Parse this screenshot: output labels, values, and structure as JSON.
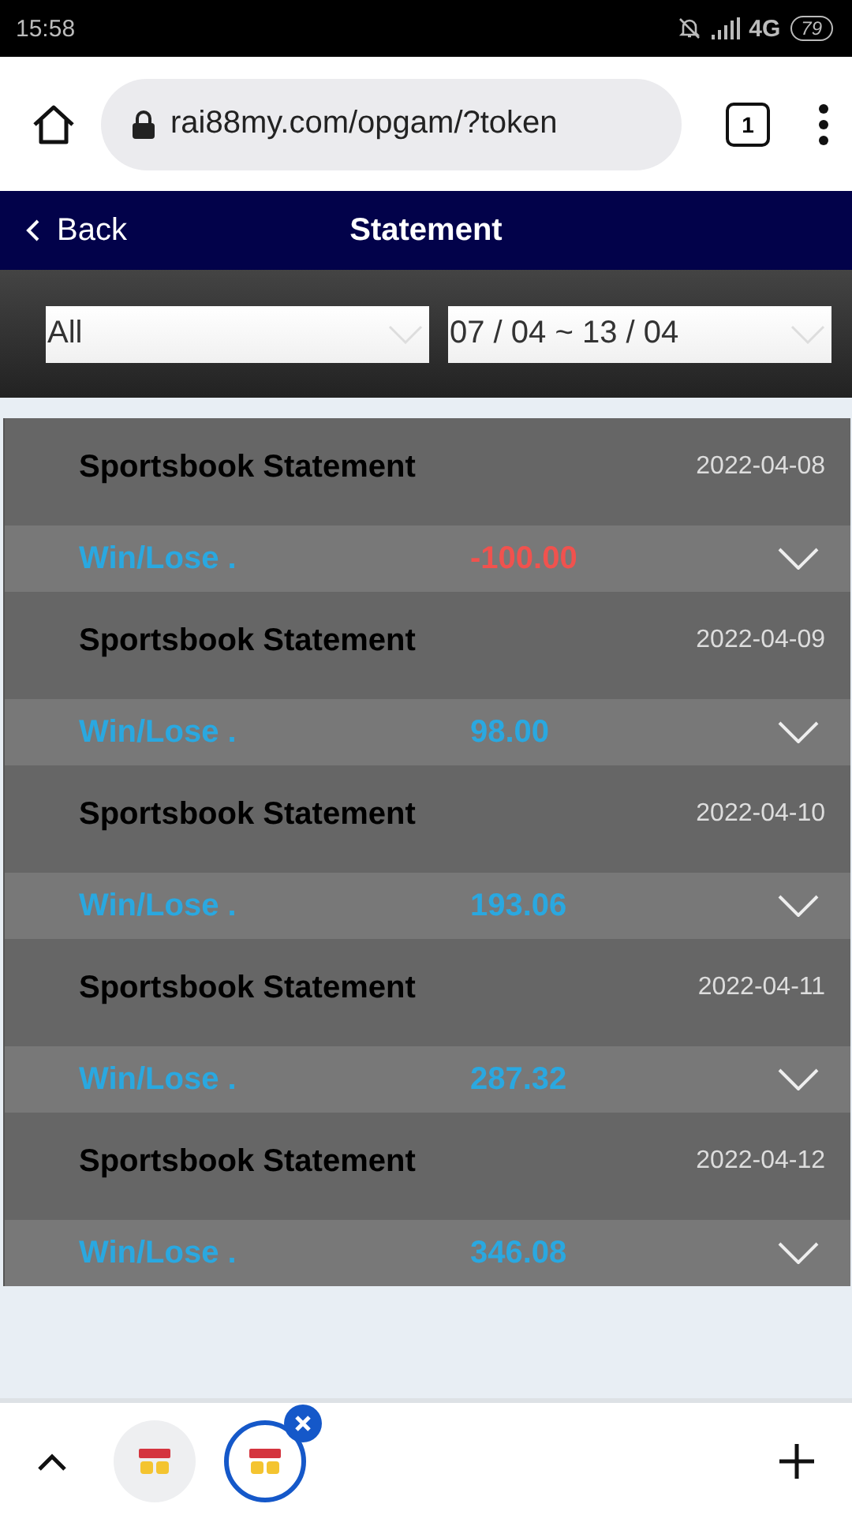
{
  "status_bar": {
    "time": "15:58",
    "network": "4G",
    "battery": "79"
  },
  "browser": {
    "url": "rai88my.com/opgam/?token",
    "tab_count": "1"
  },
  "header": {
    "back": "Back",
    "title": "Statement"
  },
  "filters": [
    {
      "value": "All"
    },
    {
      "value": "07 / 04 ~ 13 / 04"
    }
  ],
  "statements": [
    {
      "title": "Sportsbook Statement",
      "date": "2022-04-08",
      "label": "Win/Lose .",
      "amount": "-100.00",
      "color": "#f0524e"
    },
    {
      "title": "Sportsbook Statement",
      "date": "2022-04-09",
      "label": "Win/Lose .",
      "amount": "98.00",
      "color": "#2aa8e0"
    },
    {
      "title": "Sportsbook Statement",
      "date": "2022-04-10",
      "label": "Win/Lose .",
      "amount": "193.06",
      "color": "#2aa8e0"
    },
    {
      "title": "Sportsbook Statement",
      "date": "2022-04-11",
      "label": "Win/Lose .",
      "amount": "287.32",
      "color": "#2aa8e0"
    },
    {
      "title": "Sportsbook Statement",
      "date": "2022-04-12",
      "label": "Win/Lose .",
      "amount": "346.08",
      "color": "#2aa8e0"
    }
  ],
  "tab_groups": [
    {
      "selected": false
    },
    {
      "selected": true
    }
  ]
}
